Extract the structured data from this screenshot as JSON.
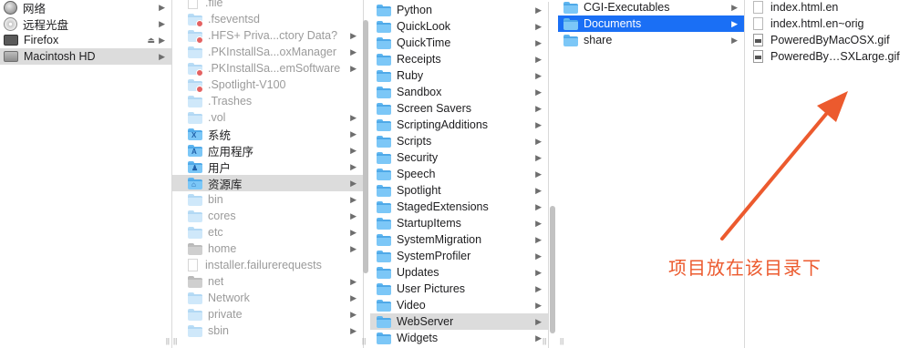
{
  "sidebar": {
    "items": [
      {
        "label": "网络",
        "icon": "network-globe-icon",
        "chevron": "▶"
      },
      {
        "label": "远程光盘",
        "icon": "remote-disc-icon",
        "chevron": "▶"
      },
      {
        "label": "Firefox",
        "icon": "disk-image-icon",
        "chevron": "▶",
        "eject": "⏏"
      },
      {
        "label": "Macintosh HD",
        "icon": "hard-drive-icon",
        "chevron": "▶"
      }
    ]
  },
  "col_root": {
    "items": [
      {
        "label": ".file",
        "chevron": ""
      },
      {
        "label": ".fseventsd",
        "chevron": ""
      },
      {
        "label": ".HFS+ Priva...ctory Data?",
        "chevron": "▶"
      },
      {
        "label": ".PKInstallSa...oxManager",
        "chevron": "▶"
      },
      {
        "label": ".PKInstallSa...emSoftware",
        "chevron": "▶"
      },
      {
        "label": ".Spotlight-V100",
        "chevron": ""
      },
      {
        "label": ".Trashes",
        "chevron": ""
      },
      {
        "label": ".vol",
        "chevron": "▶"
      },
      {
        "label": "系统",
        "chevron": "▶"
      },
      {
        "label": "应用程序",
        "chevron": "▶"
      },
      {
        "label": "用户",
        "chevron": "▶"
      },
      {
        "label": "资源库",
        "chevron": "▶"
      },
      {
        "label": "bin",
        "chevron": "▶"
      },
      {
        "label": "cores",
        "chevron": "▶"
      },
      {
        "label": "etc",
        "chevron": "▶"
      },
      {
        "label": "home",
        "chevron": "▶"
      },
      {
        "label": "installer.failurerequests",
        "chevron": ""
      },
      {
        "label": "net",
        "chevron": "▶"
      },
      {
        "label": "Network",
        "chevron": "▶"
      },
      {
        "label": "private",
        "chevron": "▶"
      },
      {
        "label": "sbin",
        "chevron": "▶"
      }
    ]
  },
  "col_library": {
    "items": [
      {
        "label": "Python",
        "chevron": "▶"
      },
      {
        "label": "QuickLook",
        "chevron": "▶"
      },
      {
        "label": "QuickTime",
        "chevron": "▶"
      },
      {
        "label": "Receipts",
        "chevron": "▶"
      },
      {
        "label": "Ruby",
        "chevron": "▶"
      },
      {
        "label": "Sandbox",
        "chevron": "▶"
      },
      {
        "label": "Screen Savers",
        "chevron": "▶"
      },
      {
        "label": "ScriptingAdditions",
        "chevron": "▶"
      },
      {
        "label": "Scripts",
        "chevron": "▶"
      },
      {
        "label": "Security",
        "chevron": "▶"
      },
      {
        "label": "Speech",
        "chevron": "▶"
      },
      {
        "label": "Spotlight",
        "chevron": "▶"
      },
      {
        "label": "StagedExtensions",
        "chevron": "▶"
      },
      {
        "label": "StartupItems",
        "chevron": "▶"
      },
      {
        "label": "SystemMigration",
        "chevron": "▶"
      },
      {
        "label": "SystemProfiler",
        "chevron": "▶"
      },
      {
        "label": "Updates",
        "chevron": "▶"
      },
      {
        "label": "User Pictures",
        "chevron": "▶"
      },
      {
        "label": "Video",
        "chevron": "▶"
      },
      {
        "label": "WebServer",
        "chevron": "▶"
      },
      {
        "label": "Widgets",
        "chevron": "▶"
      }
    ]
  },
  "col_webserver": {
    "items": [
      {
        "label": "CGI-Executables",
        "chevron": "▶"
      },
      {
        "label": "Documents",
        "chevron": "▶"
      },
      {
        "label": "share",
        "chevron": "▶"
      }
    ]
  },
  "col_documents": {
    "items": [
      {
        "label": "index.html.en",
        "type": "html"
      },
      {
        "label": "index.html.en~orig",
        "type": "html"
      },
      {
        "label": "PoweredByMacOSX.gif",
        "type": "gif"
      },
      {
        "label": "PoweredBy…SXLarge.gif",
        "type": "gif"
      }
    ]
  },
  "resize_glyph": "||",
  "annotation": {
    "text": "项目放在该目录下",
    "color": "#ec5a2e"
  },
  "colors": {
    "selection_blue": "#1a6ff5",
    "selection_gray": "#dcdcdc",
    "folder_blue": "#7cc7f7"
  }
}
